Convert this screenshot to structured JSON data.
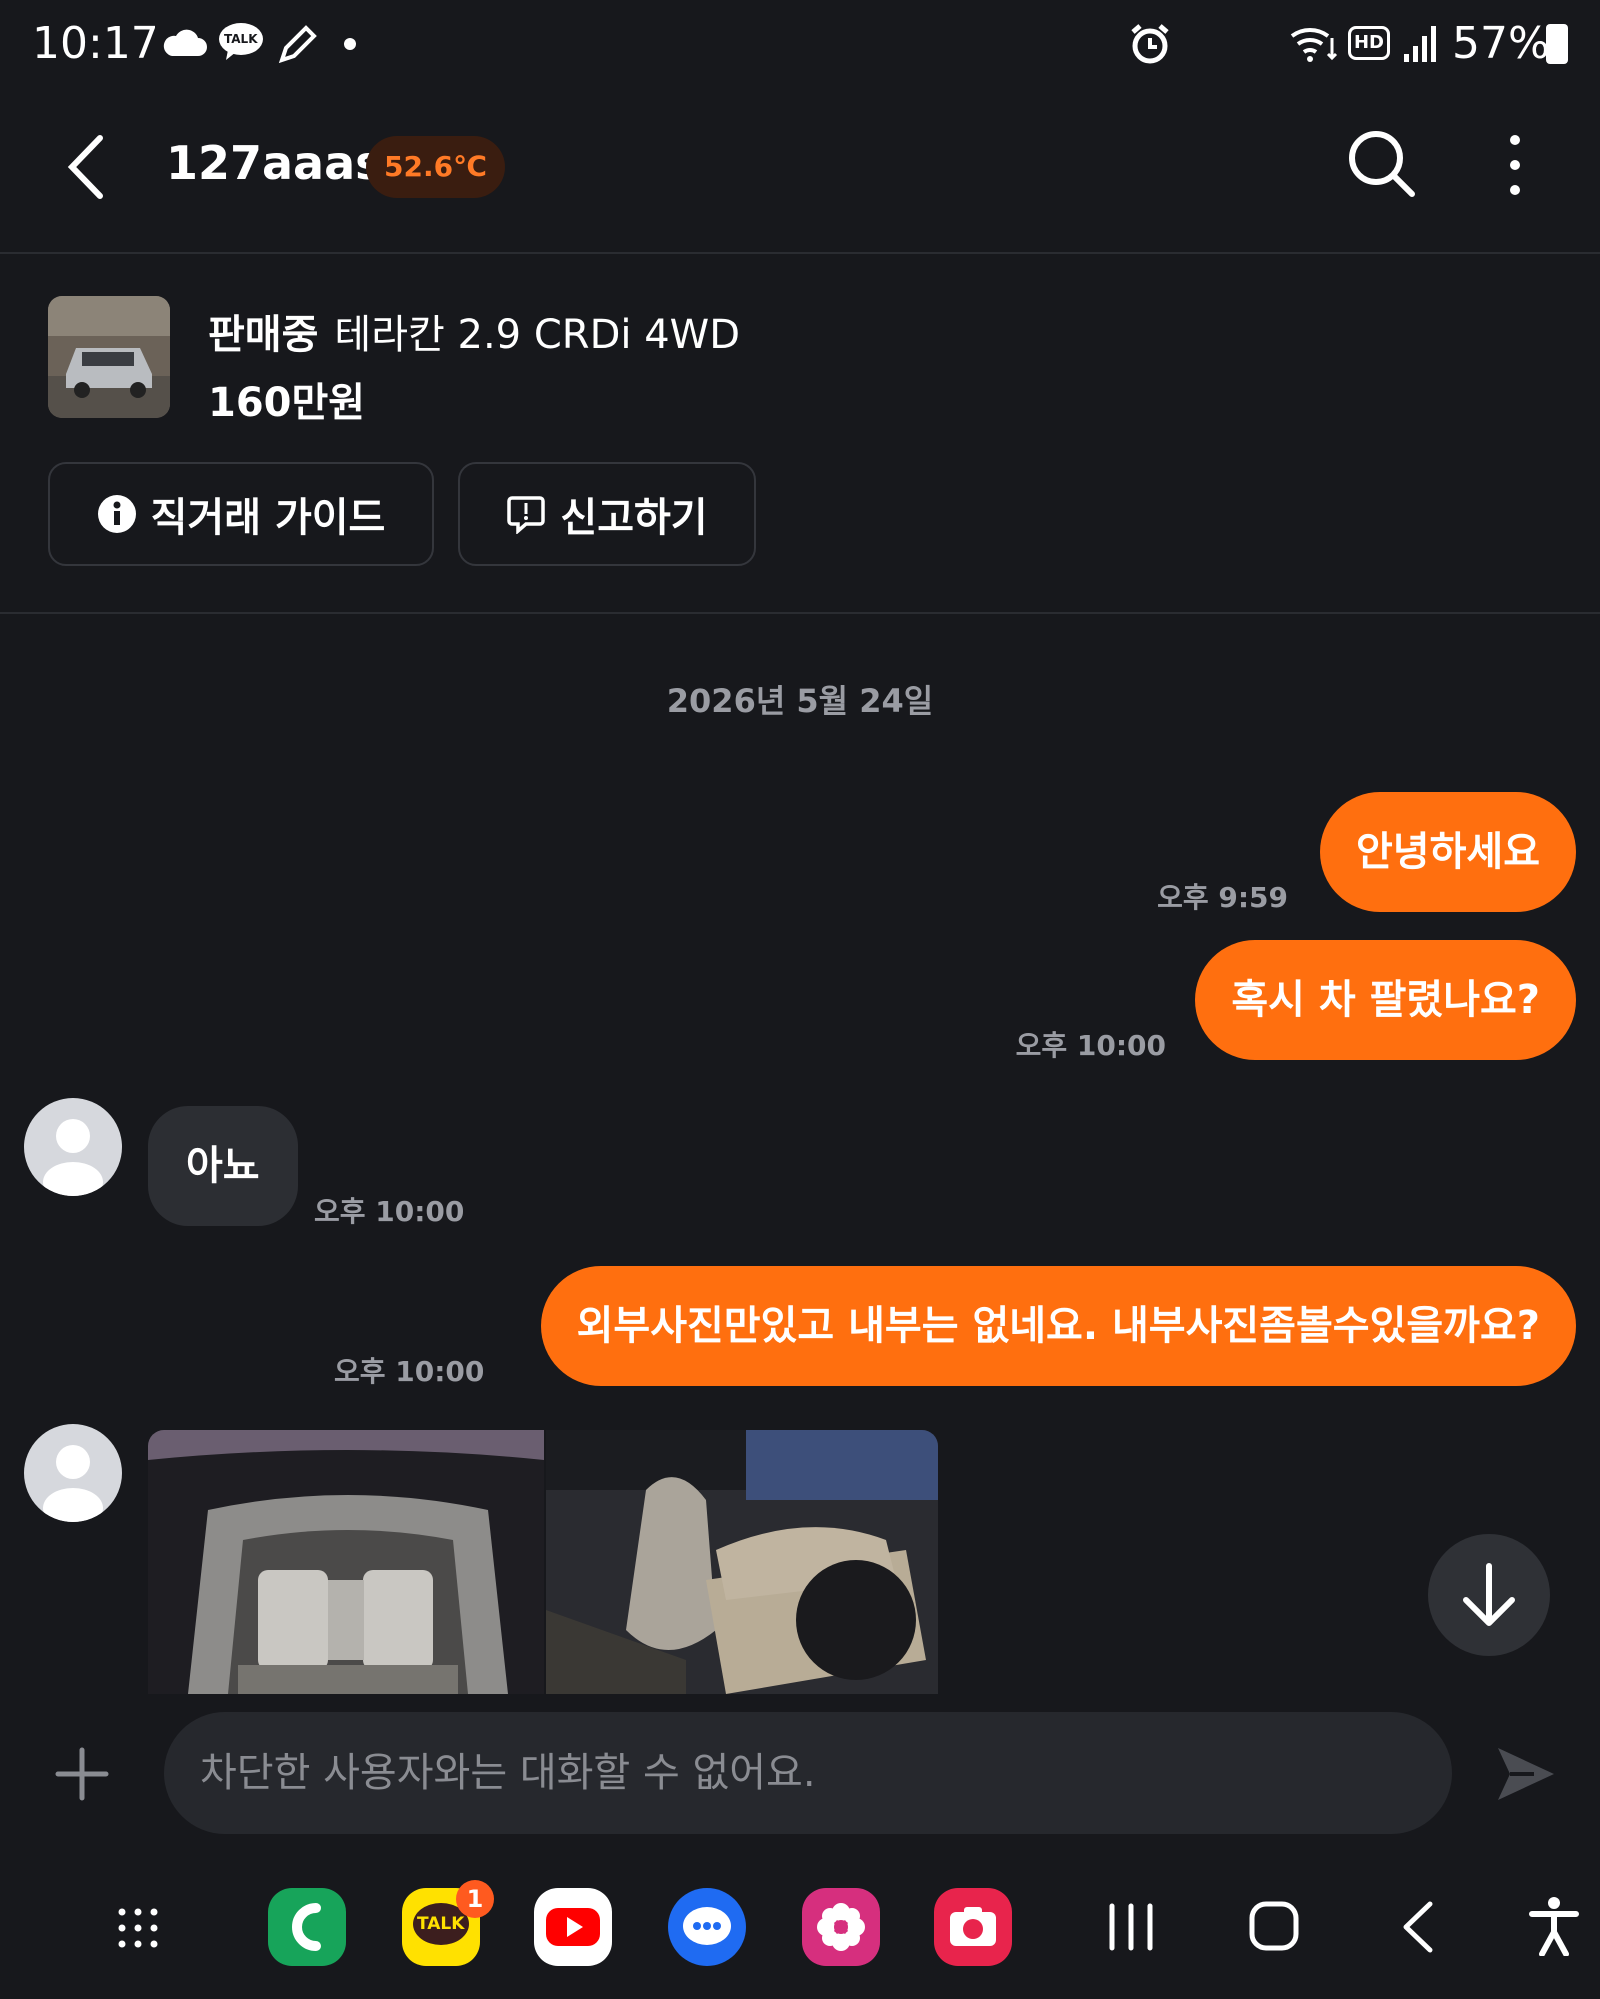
{
  "status_bar": {
    "time": "10:17",
    "battery": "57%",
    "icons": [
      "cloud-icon",
      "kakaotalk-icon",
      "pen-icon",
      "dot-icon",
      "alarm-icon",
      "wifi-icon",
      "hd-icon",
      "signal-icon",
      "battery-icon"
    ],
    "talk_label": "TALK",
    "hd_label": "HD"
  },
  "header": {
    "title": "127aaas",
    "temperature": "52.6℃",
    "temperature_color": "#ff7a26"
  },
  "product": {
    "status": "판매중",
    "name": "테라칸 2.9 CRDi 4WD",
    "price": "160만원",
    "guide_button": "직거래 가이드",
    "report_button": "신고하기"
  },
  "chat": {
    "date": "2026년 5월 24일",
    "messages": [
      {
        "from": "me",
        "text": "안녕하세요",
        "time": "오후 9:59"
      },
      {
        "from": "me",
        "text": "혹시 차 팔렸나요?",
        "time": "오후 10:00"
      },
      {
        "from": "them",
        "text": "아뇨",
        "time": "오후 10:00"
      },
      {
        "from": "me",
        "text": "외부사진만있고 내부는 없네요. 내부사진좀볼수있을까요?",
        "time": "오후 10:00"
      }
    ]
  },
  "input": {
    "placeholder": "차단한 사용자와는 대화할 수 없어요."
  },
  "nav": {
    "kakao_badge": "1",
    "kakao_label": "TALK"
  },
  "colors": {
    "accent": "#ff6f0f",
    "background": "#17181c"
  }
}
